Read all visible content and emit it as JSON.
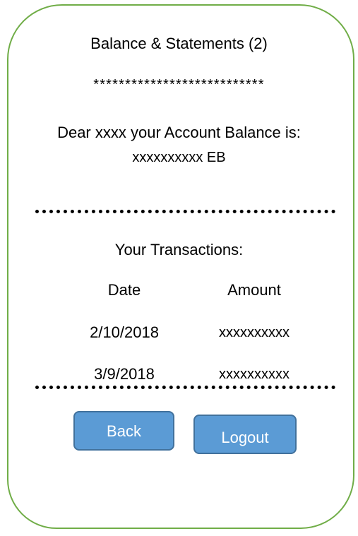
{
  "screen": {
    "title": "Balance & Statements (2)",
    "separator_stars": "***************************",
    "greeting": "Dear xxxx your Account Balance is:",
    "balance_value": "xxxxxxxxxx EB",
    "transactions_heading": "Your Transactions:"
  },
  "transactions": {
    "columns": [
      "Date",
      "Amount"
    ],
    "rows": [
      {
        "date": "2/10/2018",
        "amount": "xxxxxxxxxx"
      },
      {
        "date": "3/9/2018",
        "amount": "xxxxxxxxxx"
      }
    ]
  },
  "buttons": {
    "back_label": "Back",
    "logout_label": "Logout"
  },
  "colors": {
    "frame_border": "#70ad47",
    "button_fill": "#5b9bd5",
    "button_border": "#41719c",
    "button_text": "#ffffff"
  }
}
